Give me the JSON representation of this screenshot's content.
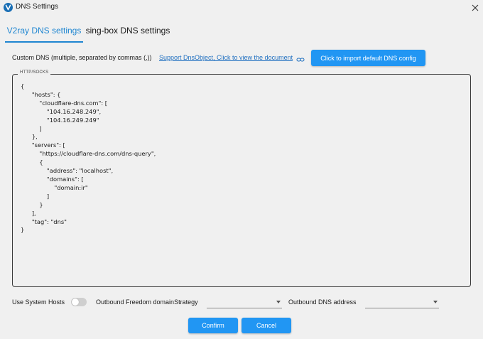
{
  "window": {
    "title": "DNS Settings",
    "app_icon": "v2rayn-logo-icon",
    "close_icon": "close-icon"
  },
  "tabs": [
    {
      "label": "V2ray DNS settings",
      "active": true
    },
    {
      "label": "sing-box DNS settings",
      "active": false
    }
  ],
  "custom_dns": {
    "label": "Custom DNS (multiple, separated by commas (,))",
    "doc_link": "Support DnsObject, Click to view the document",
    "link_icon": "link-icon",
    "import_button": "Click to import default DNS config"
  },
  "editor": {
    "legend": "HTTP/SOCKS",
    "content": "{\n      \"hosts\": {\n          \"cloudflare-dns.com\": [\n              \"104.16.248.249\",\n              \"104.16.249.249\"\n          ]\n      },\n      \"servers\": [\n          \"https://cloudflare-dns.com/dns-query\",\n          {\n              \"address\": \"localhost\",\n              \"domains\": [\n                  \"domain:ir\"\n              ]\n          }\n      ],\n      \"tag\": \"dns\"\n}"
  },
  "options": {
    "use_system_hosts_label": "Use System Hosts",
    "use_system_hosts_on": false,
    "strategy_label": "Outbound Freedom domainStrategy",
    "strategy_value": "",
    "dns_address_label": "Outbound DNS address",
    "dns_address_value": ""
  },
  "buttons": {
    "confirm": "Confirm",
    "cancel": "Cancel"
  },
  "colors": {
    "accent": "#2196f3",
    "link": "#1f6fc0",
    "background": "#f0f0f0"
  }
}
